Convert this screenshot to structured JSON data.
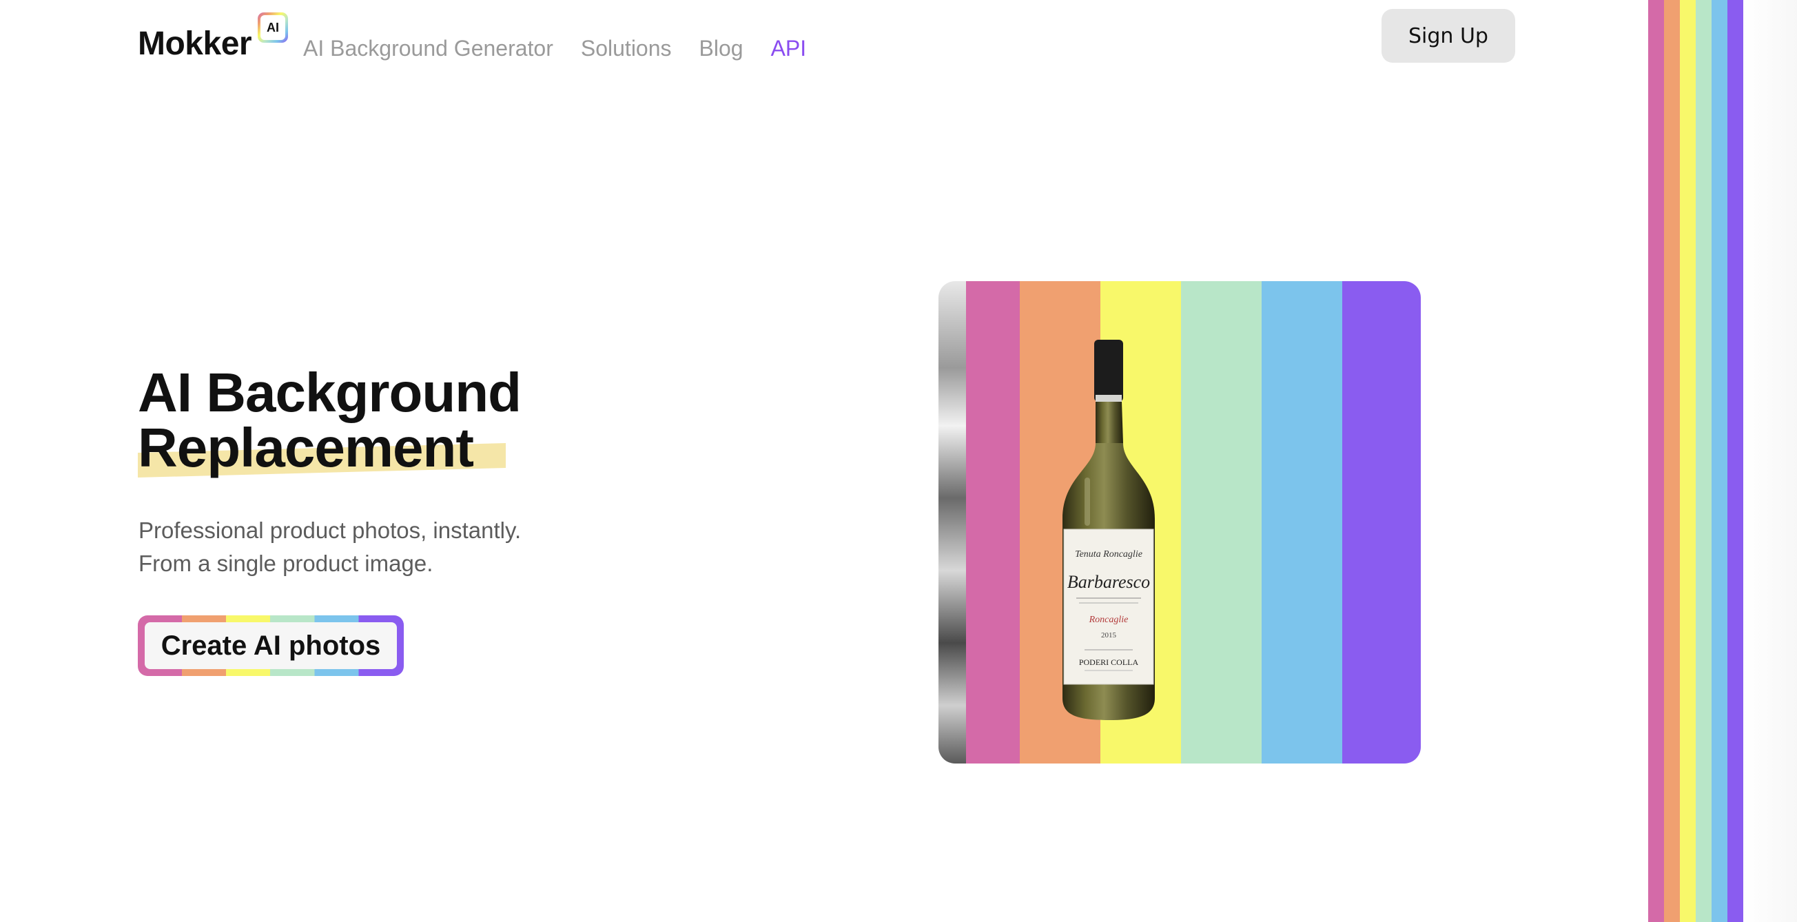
{
  "brand": {
    "name": "Mokker",
    "badge": "AI"
  },
  "nav": {
    "items": [
      {
        "label": "AI Background Generator",
        "active": false
      },
      {
        "label": "Solutions",
        "active": false
      },
      {
        "label": "Blog",
        "active": false
      },
      {
        "label": "API",
        "active": true
      }
    ],
    "active_color": "#8a4cf0"
  },
  "header": {
    "signup_label": "Sign Up"
  },
  "hero": {
    "title_line1": "AI Background",
    "title_line2": "Replacement",
    "subtitle_line1": "Professional product photos, instantly.",
    "subtitle_line2": "From a single product image.",
    "cta_label": "Create AI photos"
  },
  "product_image": {
    "subject": "wine-bottle",
    "label_lines": [
      "Tenuta Roncaglie",
      "Barbaresco",
      "Roncaglie",
      "2015",
      "PODERI COLLA"
    ]
  },
  "colors": {
    "rainbow": [
      "#d46aa8",
      "#f0a070",
      "#f8f86a",
      "#b8e6c8",
      "#7cc4ec",
      "#8a5cf0"
    ],
    "highlight": "#f5e6a8",
    "signup_bg": "#e6e6e6"
  }
}
